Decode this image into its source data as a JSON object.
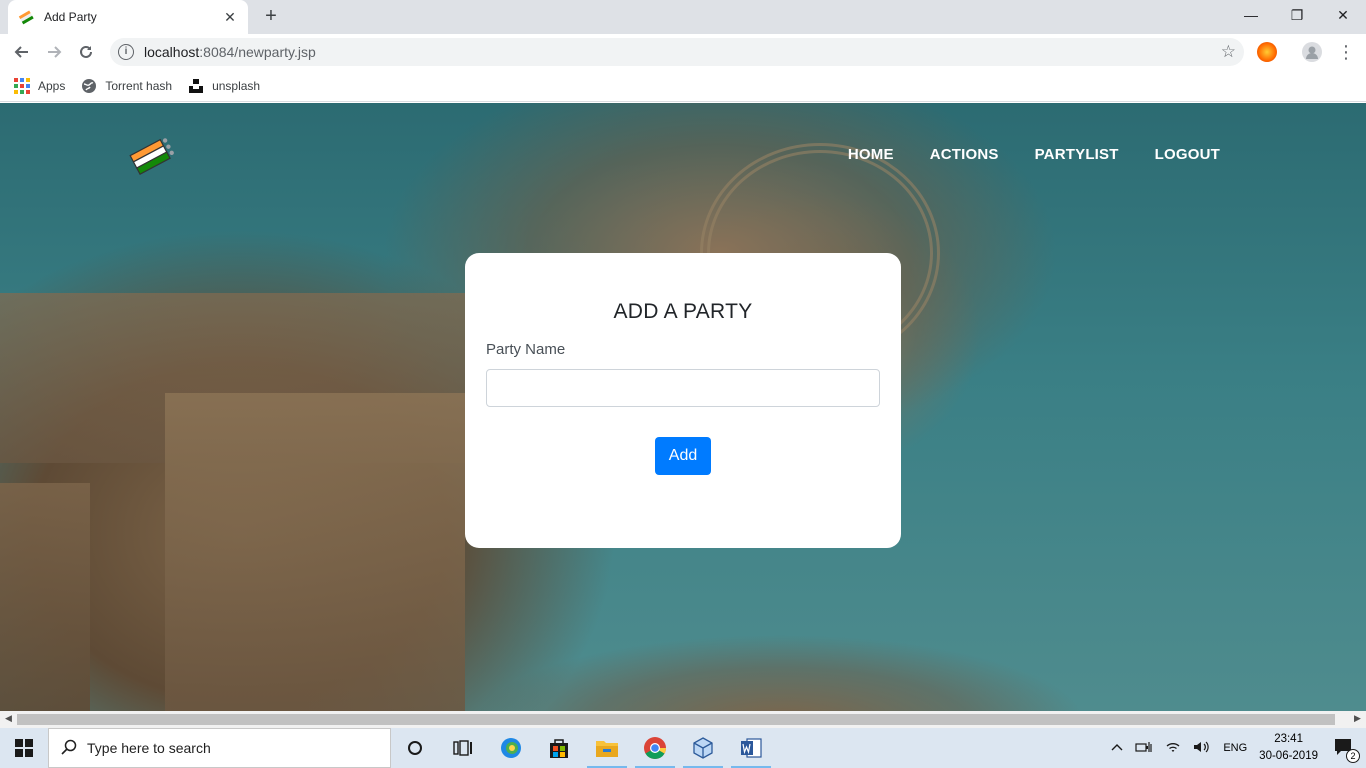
{
  "browser": {
    "tab_title": "Add Party",
    "tab_close": "✕",
    "new_tab": "+",
    "url_host": "localhost",
    "url_rest": ":8084/newparty.jsp",
    "window_controls": {
      "minimize": "—",
      "restore": "❐",
      "close": "✕"
    },
    "bookmarks": [
      {
        "label": "Apps",
        "icon": "apps-grid-icon"
      },
      {
        "label": "Torrent hash",
        "icon": "globe-icon"
      },
      {
        "label": "unsplash",
        "icon": "unsplash-icon"
      }
    ]
  },
  "site": {
    "nav": [
      "HOME",
      "ACTIONS",
      "PARTYLIST",
      "LOGOUT"
    ],
    "logo": "ballot-logo-icon"
  },
  "form": {
    "title": "ADD A PARTY",
    "party_name_label": "Party Name",
    "party_name_value": "",
    "add_button": "Add"
  },
  "taskbar": {
    "search_placeholder": "Type here to search",
    "language": "ENG",
    "time": "23:41",
    "date": "30-06-2019",
    "notification_count": "2"
  },
  "colors": {
    "primary": "#007bff",
    "sky": "#3a7f85",
    "stone": "#7c6448"
  }
}
